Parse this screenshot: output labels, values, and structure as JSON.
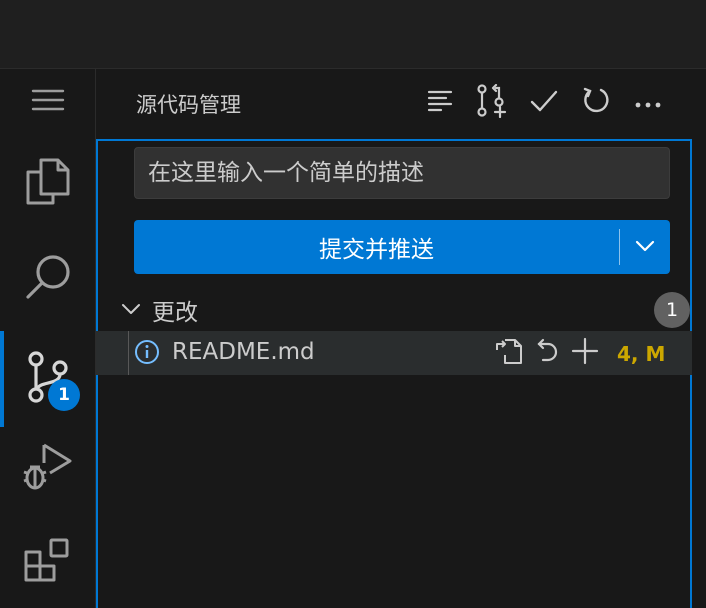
{
  "activity_bar": {
    "menu_icon": "hamburger-menu-icon",
    "items": [
      {
        "name": "explorer",
        "icon": "files-icon"
      },
      {
        "name": "search",
        "icon": "search-icon"
      },
      {
        "name": "source-control",
        "icon": "source-control-icon",
        "badge": "1",
        "active": true
      },
      {
        "name": "run-debug",
        "icon": "run-debug-icon"
      },
      {
        "name": "extensions",
        "icon": "extensions-icon"
      }
    ]
  },
  "sidebar": {
    "title": "源代码管理",
    "header_actions": [
      "list-icon",
      "pull-request-icon",
      "check-icon",
      "refresh-icon",
      "more-icon"
    ],
    "commit": {
      "message_placeholder": "在这里输入一个简单的描述",
      "message_value": "",
      "button_label": "提交并推送"
    },
    "changes": {
      "label": "更改",
      "count": "1",
      "files": [
        {
          "name": "README.md",
          "status": "4, M",
          "icon": "info-icon",
          "actions": [
            "open-file-icon",
            "discard-icon",
            "stage-icon"
          ]
        }
      ]
    }
  },
  "colors": {
    "accent": "#0078d4",
    "modified": "#cca700",
    "background": "#181818"
  }
}
